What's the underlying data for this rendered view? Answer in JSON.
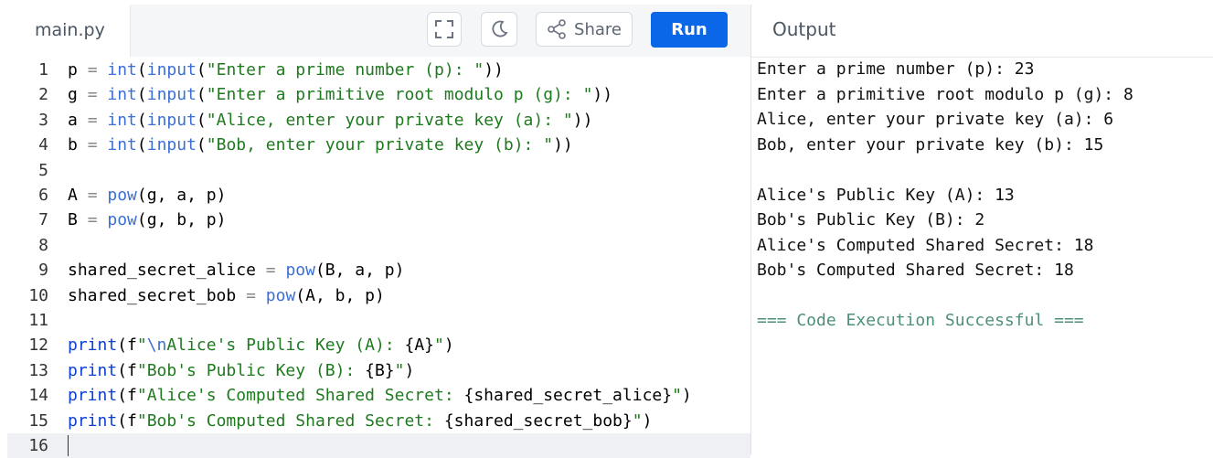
{
  "editor": {
    "filename": "main.py",
    "share_label": "Share",
    "run_label": "Run",
    "lines": [
      {
        "n": "1",
        "code": "p = int(input(\"Enter a prime number (p): \"))"
      },
      {
        "n": "2",
        "code": "g = int(input(\"Enter a primitive root modulo p (g): \"))"
      },
      {
        "n": "3",
        "code": "a = int(input(\"Alice, enter your private key (a): \"))"
      },
      {
        "n": "4",
        "code": "b = int(input(\"Bob, enter your private key (b): \"))"
      },
      {
        "n": "5",
        "code": ""
      },
      {
        "n": "6",
        "code": "A = pow(g, a, p)"
      },
      {
        "n": "7",
        "code": "B = pow(g, b, p)"
      },
      {
        "n": "8",
        "code": ""
      },
      {
        "n": "9",
        "code": "shared_secret_alice = pow(B, a, p)"
      },
      {
        "n": "10",
        "code": "shared_secret_bob = pow(A, b, p)"
      },
      {
        "n": "11",
        "code": ""
      },
      {
        "n": "12",
        "code": "print(f\"\\nAlice's Public Key (A): {A}\")"
      },
      {
        "n": "13",
        "code": "print(f\"Bob's Public Key (B): {B}\")"
      },
      {
        "n": "14",
        "code": "print(f\"Alice's Computed Shared Secret: {shared_secret_alice}\")"
      },
      {
        "n": "15",
        "code": "print(f\"Bob's Computed Shared Secret: {shared_secret_bob}\")"
      },
      {
        "n": "16",
        "code": ""
      }
    ]
  },
  "output": {
    "title": "Output",
    "lines": [
      "Enter a prime number (p): 23",
      "Enter a primitive root modulo p (g): 8",
      "Alice, enter your private key (a): 6",
      "Bob, enter your private key (b): 15",
      "",
      "Alice's Public Key (A): 13",
      "Bob's Public Key (B): 2",
      "Alice's Computed Shared Secret: 18",
      "Bob's Computed Shared Secret: 18",
      "",
      "=== Code Execution Successful ==="
    ]
  },
  "icons": {
    "fullscreen": "fullscreen-icon",
    "theme": "moon-icon",
    "share": "share-icon"
  },
  "colors": {
    "run_button": "#0a67e8",
    "keyword": "#0b3fd6",
    "string": "#1e7a1e",
    "success": "#4f8f7a"
  }
}
